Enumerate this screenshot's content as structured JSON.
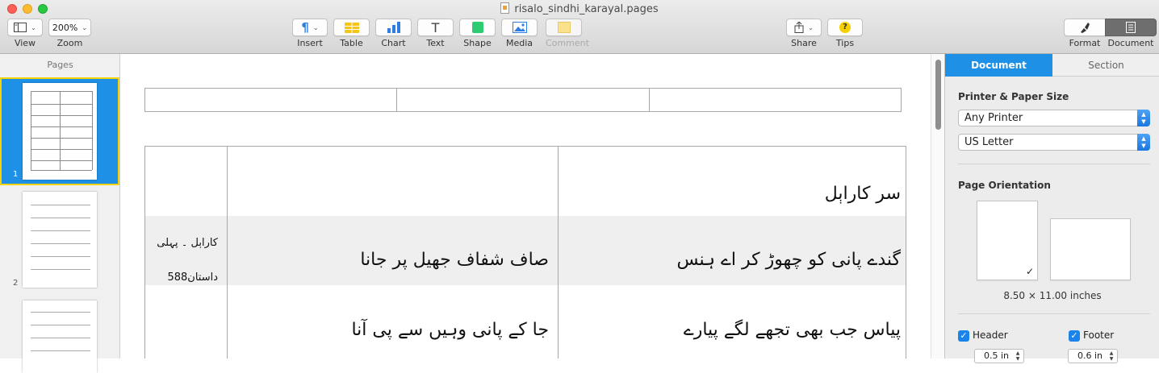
{
  "window": {
    "title": "risalo_sindhi_karayal.pages"
  },
  "toolbar": {
    "view_label": "View",
    "zoom_value": "200%",
    "zoom_label": "Zoom",
    "insert_label": "Insert",
    "table_label": "Table",
    "chart_label": "Chart",
    "text_label": "Text",
    "shape_label": "Shape",
    "media_label": "Media",
    "comment_label": "Comment",
    "share_label": "Share",
    "tips_label": "Tips",
    "format_label": "Format",
    "document_label": "Document",
    "colors": {
      "table_icon": "#f5c518",
      "chart_icon": "#2f7de1",
      "shape_icon": "#2ecc71",
      "tips_icon": "#f7d000"
    }
  },
  "sidebar": {
    "title": "Pages",
    "pages": [
      {
        "number": "1",
        "selected": true
      },
      {
        "number": "2",
        "selected": false
      },
      {
        "number": "",
        "selected": false
      }
    ]
  },
  "document": {
    "rows": [
      {
        "right": "سر کاراٻل",
        "middle": "",
        "left": "",
        "shaded": false
      },
      {
        "right": "گندے پانی کو چھوڑ کر اے ہنس",
        "middle": "صاف شفاف جھیل پر جانا",
        "left_line1": "کاراٻل ۔ پہلی",
        "left_line2": "داستان588",
        "shaded": true
      },
      {
        "right": "پیاس جب بھی تجھے لگے پیارے",
        "middle": "جا کے پانی وہیں سے پی آنا",
        "left": "",
        "shaded": false
      }
    ]
  },
  "inspector": {
    "tabs": [
      {
        "label": "Document",
        "active": true
      },
      {
        "label": "Section",
        "active": false
      }
    ],
    "printer_heading": "Printer & Paper Size",
    "printer_value": "Any Printer",
    "paper_value": "US Letter",
    "orientation_heading": "Page Orientation",
    "paper_size_text": "8.50 × 11.00 inches",
    "header_label": "Header",
    "header_value": "0.5 in",
    "footer_label": "Footer",
    "footer_value": "0.6 in",
    "accent_color": "#1e90e6"
  }
}
